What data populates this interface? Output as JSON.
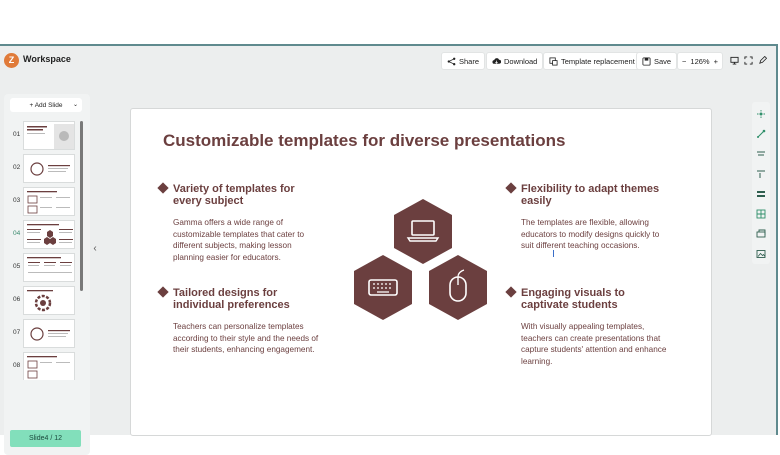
{
  "header": {
    "logo_letter": "Z",
    "workspace_label": "Workspace",
    "share_label": "Share",
    "download_label": "Download",
    "template_label": "Template replacement",
    "save_label": "Save",
    "zoom_minus": "−",
    "zoom_value": "126%",
    "zoom_plus": "+"
  },
  "sidebar": {
    "add_slide_label": "+ Add Slide",
    "slide_numbers": [
      "01",
      "02",
      "03",
      "04",
      "05",
      "06",
      "07",
      "08"
    ],
    "active_slide": "04",
    "counter": "Slide4 / 12"
  },
  "slide": {
    "title": "Customizable templates for diverse presentations",
    "items": [
      {
        "heading": "Variety of templates for every subject",
        "body": "Gamma offers a wide range of customizable templates that cater to different subjects, making lesson planning easier for educators."
      },
      {
        "heading": "Tailored designs for individual preferences",
        "body": "Teachers can personalize templates according to their style and the needs of their students, enhancing engagement."
      },
      {
        "heading": "Flexibility to adapt themes easily",
        "body": "The templates are flexible, allowing educators to modify designs quickly to suit different teaching occasions."
      },
      {
        "heading": "Engaging visuals to captivate students",
        "body": "With visually appealing templates, teachers can create presentations that capture students' attention and enhance learning."
      }
    ],
    "hex_icons": [
      "laptop-icon",
      "keyboard-icon",
      "mouse-icon"
    ]
  },
  "colors": {
    "accent": "#6b3f3f",
    "counter_bg": "#82dfbb",
    "frame": "#5f8a8e",
    "logo": "#e07b3a"
  }
}
